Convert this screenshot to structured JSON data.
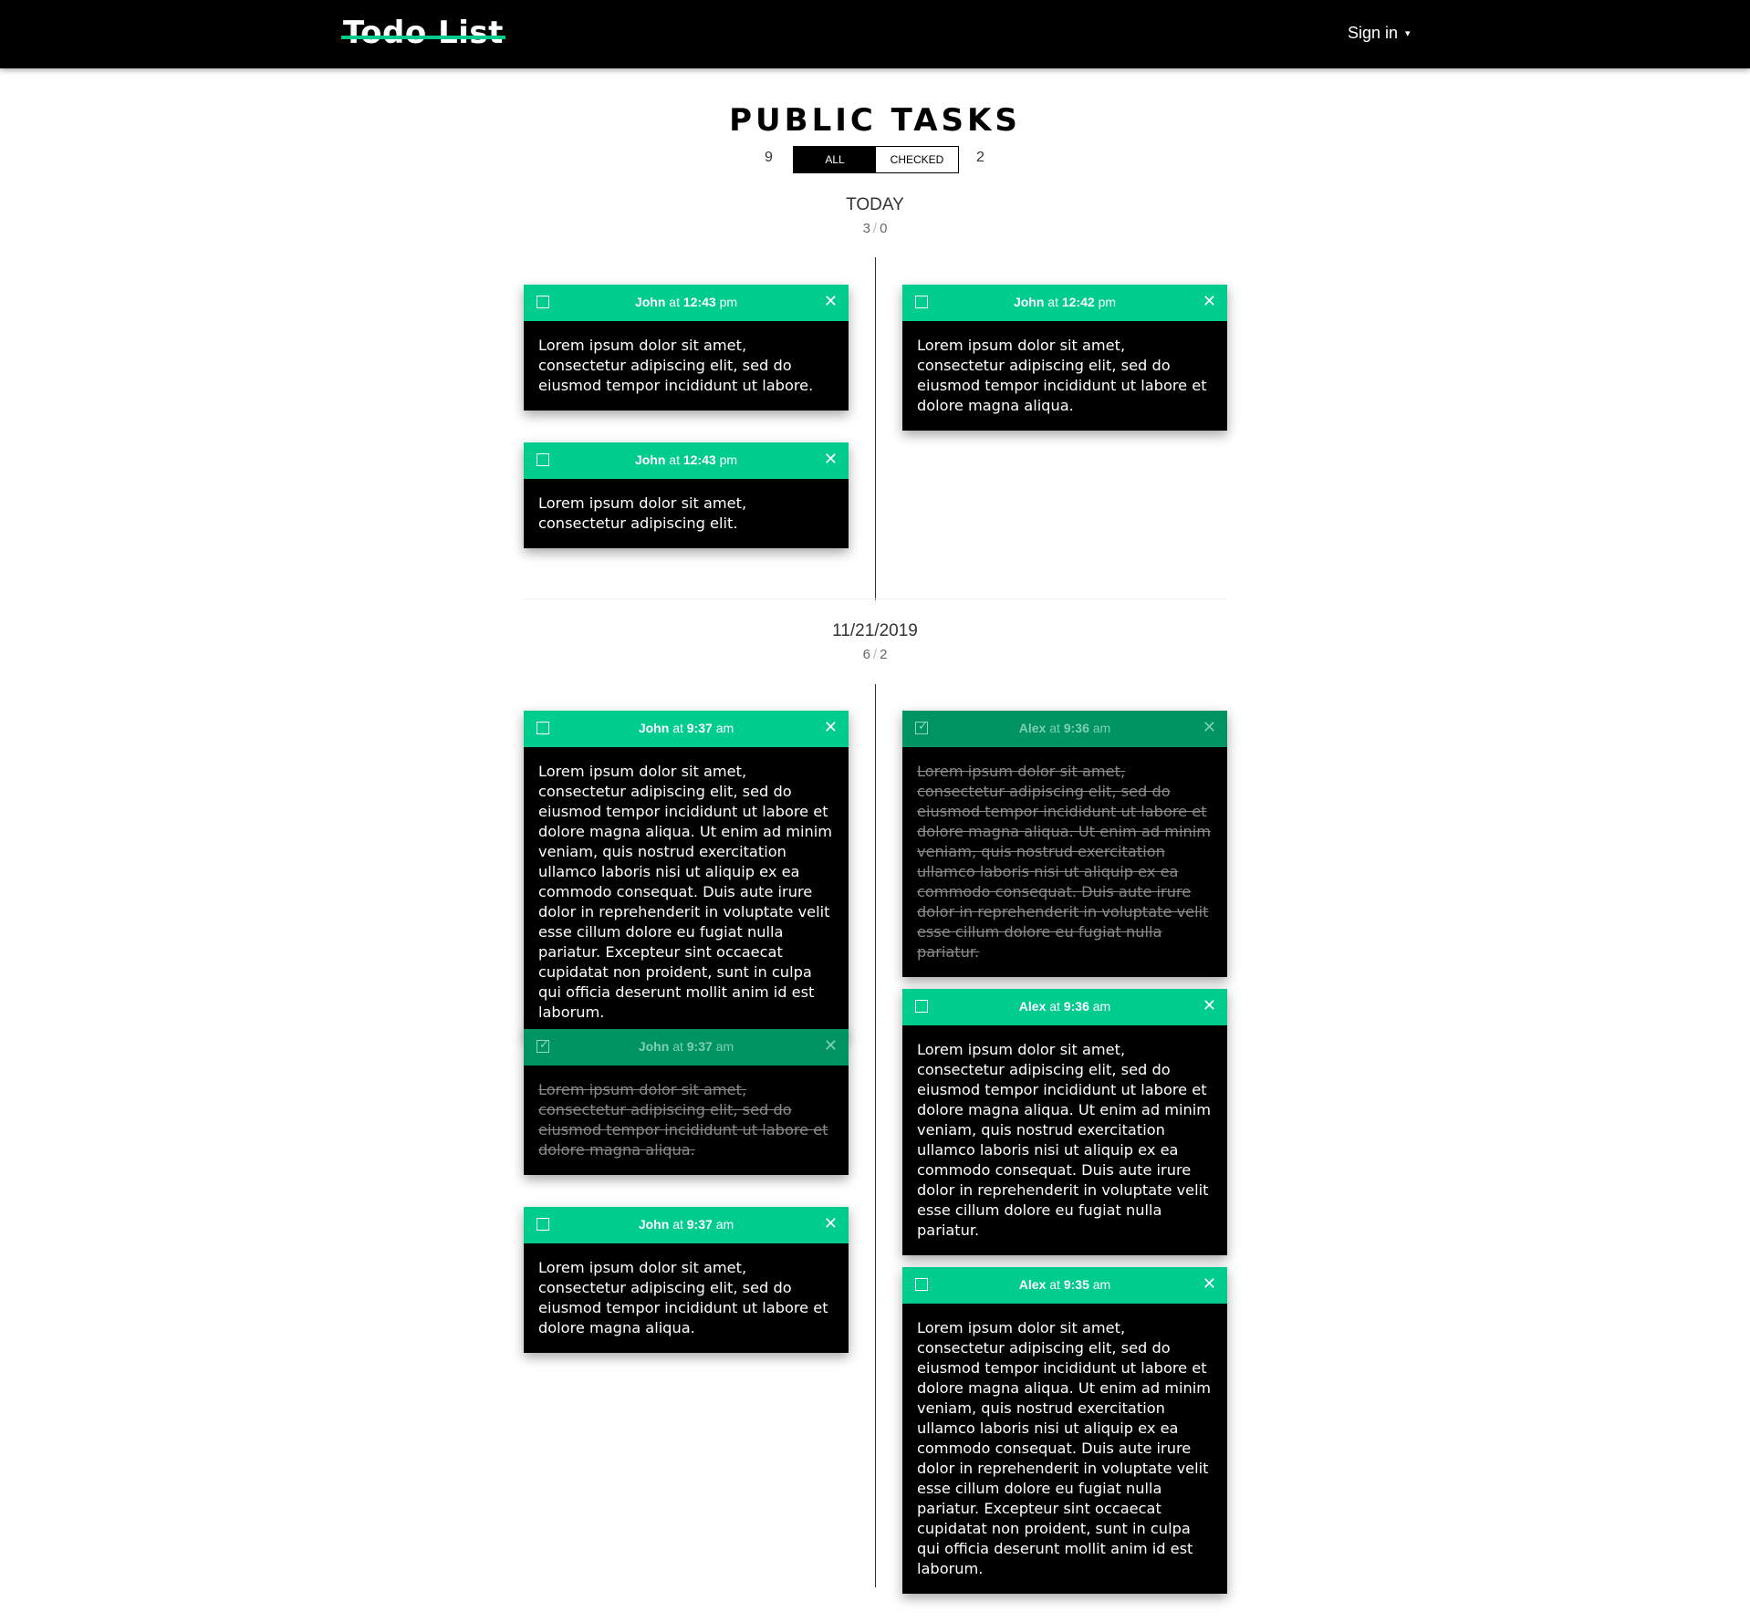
{
  "header": {
    "logo": "Todo List",
    "signin_label": "Sign in",
    "signin_caret": "▾"
  },
  "page": {
    "title": "PUBLIC TASKS",
    "total_count": "9",
    "checked_count": "2",
    "filter_all": "ALL",
    "filter_checked": "CHECKED"
  },
  "groups": [
    {
      "label": "TODAY",
      "total": "3",
      "checked": "0",
      "tasks": [
        {
          "author": "John",
          "at": "at",
          "time": "12:43",
          "ampm": "pm",
          "checked": false,
          "text": "Lorem ipsum dolor sit amet, consectetur adipiscing elit, sed do eiusmod tempor incididunt ut labore."
        },
        {
          "author": "John",
          "at": "at",
          "time": "12:42",
          "ampm": "pm",
          "checked": false,
          "text": "Lorem ipsum dolor sit amet, consectetur adipiscing elit, sed do eiusmod tempor incididunt ut labore et dolore magna aliqua."
        },
        {
          "author": "John",
          "at": "at",
          "time": "12:43",
          "ampm": "pm",
          "checked": false,
          "text": "Lorem ipsum dolor sit amet, consectetur adipiscing elit."
        }
      ]
    },
    {
      "label": "11/21/2019",
      "total": "6",
      "checked": "2",
      "tasks": [
        {
          "author": "John",
          "at": "at",
          "time": "9:37",
          "ampm": "am",
          "checked": false,
          "text": "Lorem ipsum dolor sit amet, consectetur adipiscing elit, sed do eiusmod tempor incididunt ut labore et dolore magna aliqua. Ut enim ad minim veniam, quis nostrud exercitation ullamco laboris nisi ut aliquip ex ea commodo consequat. Duis aute irure dolor in reprehenderit in voluptate velit esse cillum dolore eu fugiat nulla pariatur. Excepteur sint occaecat cupidatat non proident, sunt in culpa qui officia deserunt mollit anim id est laborum."
        },
        {
          "author": "Alex",
          "at": "at",
          "time": "9:36",
          "ampm": "am",
          "checked": true,
          "text": "Lorem ipsum dolor sit amet, consectetur adipiscing elit, sed do eiusmod tempor incididunt ut labore et dolore magna aliqua. Ut enim ad minim veniam, quis nostrud exercitation ullamco laboris nisi ut aliquip ex ea commodo consequat. Duis aute irure dolor in reprehenderit in voluptate velit esse cillum dolore eu fugiat nulla pariatur."
        },
        {
          "author": "John",
          "at": "at",
          "time": "9:37",
          "ampm": "am",
          "checked": true,
          "text": "Lorem ipsum dolor sit amet, consectetur adipiscing elit, sed do eiusmod tempor incididunt ut labore et dolore magna aliqua."
        },
        {
          "author": "Alex",
          "at": "at",
          "time": "9:36",
          "ampm": "am",
          "checked": false,
          "text": "Lorem ipsum dolor sit amet, consectetur adipiscing elit, sed do eiusmod tempor incididunt ut labore et dolore magna aliqua. Ut enim ad minim veniam, quis nostrud exercitation ullamco laboris nisi ut aliquip ex ea commodo consequat. Duis aute irure dolor in reprehenderit in voluptate velit esse cillum dolore eu fugiat nulla pariatur."
        },
        {
          "author": "John",
          "at": "at",
          "time": "9:37",
          "ampm": "am",
          "checked": false,
          "text": "Lorem ipsum dolor sit amet, consectetur adipiscing elit, sed do eiusmod tempor incididunt ut labore et dolore magna aliqua."
        },
        {
          "author": "Alex",
          "at": "at",
          "time": "9:35",
          "ampm": "am",
          "checked": false,
          "text": "Lorem ipsum dolor sit amet, consectetur adipiscing elit, sed do eiusmod tempor incididunt ut labore et dolore magna aliqua. Ut enim ad minim veniam, quis nostrud exercitation ullamco laboris nisi ut aliquip ex ea commodo consequat. Duis aute irure dolor in reprehenderit in voluptate velit esse cillum dolore eu fugiat nulla pariatur. Excepteur sint occaecat cupidatat non proident, sunt in culpa qui officia deserunt mollit anim id est laborum."
        }
      ]
    }
  ],
  "icons": {
    "checkbox": "checkbox-icon",
    "close": "close-icon",
    "check": "check-icon"
  },
  "colors": {
    "accent": "#00cc8e",
    "accent_checked": "#009463",
    "card_bg": "#000000",
    "topbar": "#000000"
  }
}
